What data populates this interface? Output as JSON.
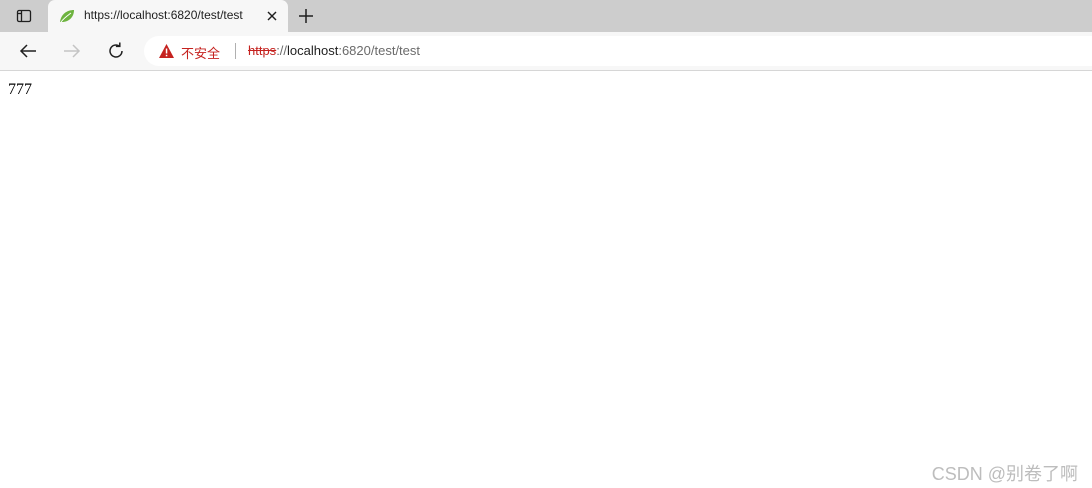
{
  "browser": {
    "tab": {
      "title": "https://localhost:6820/test/test"
    },
    "address_bar": {
      "security_label": "不安全",
      "url_scheme": "https",
      "url_separator": "://",
      "url_host": "localhost",
      "url_rest": ":6820/test/test"
    },
    "icons": {
      "tab_actions": "tab-actions-icon",
      "favicon": "spring-leaf-icon",
      "close": "close-icon",
      "new_tab": "plus-icon",
      "back": "back-arrow-icon",
      "forward": "forward-arrow-icon",
      "refresh": "refresh-icon",
      "warning": "warning-icon"
    },
    "colors": {
      "warning": "#c5221f",
      "favicon": "#6db33f"
    }
  },
  "page": {
    "body_text": "777"
  },
  "watermark": {
    "text": "CSDN @别卷了啊"
  }
}
